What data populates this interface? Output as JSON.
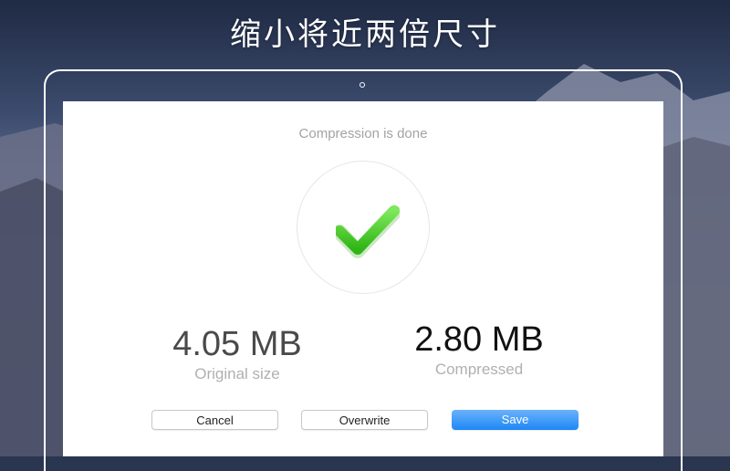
{
  "headline": "缩小将近两倍尺寸",
  "dialog": {
    "status": "Compression is done",
    "original": {
      "value": "4.05 MB",
      "label": "Original size"
    },
    "compressed": {
      "value": "2.80 MB",
      "label": "Compressed"
    },
    "buttons": {
      "cancel": "Cancel",
      "overwrite": "Overwrite",
      "save": "Save"
    }
  },
  "icons": {
    "status": "checkmark-icon"
  },
  "colors": {
    "check": "#3ec41a",
    "save_button": "#2a8ff7",
    "status_text": "#a3a3a3"
  }
}
